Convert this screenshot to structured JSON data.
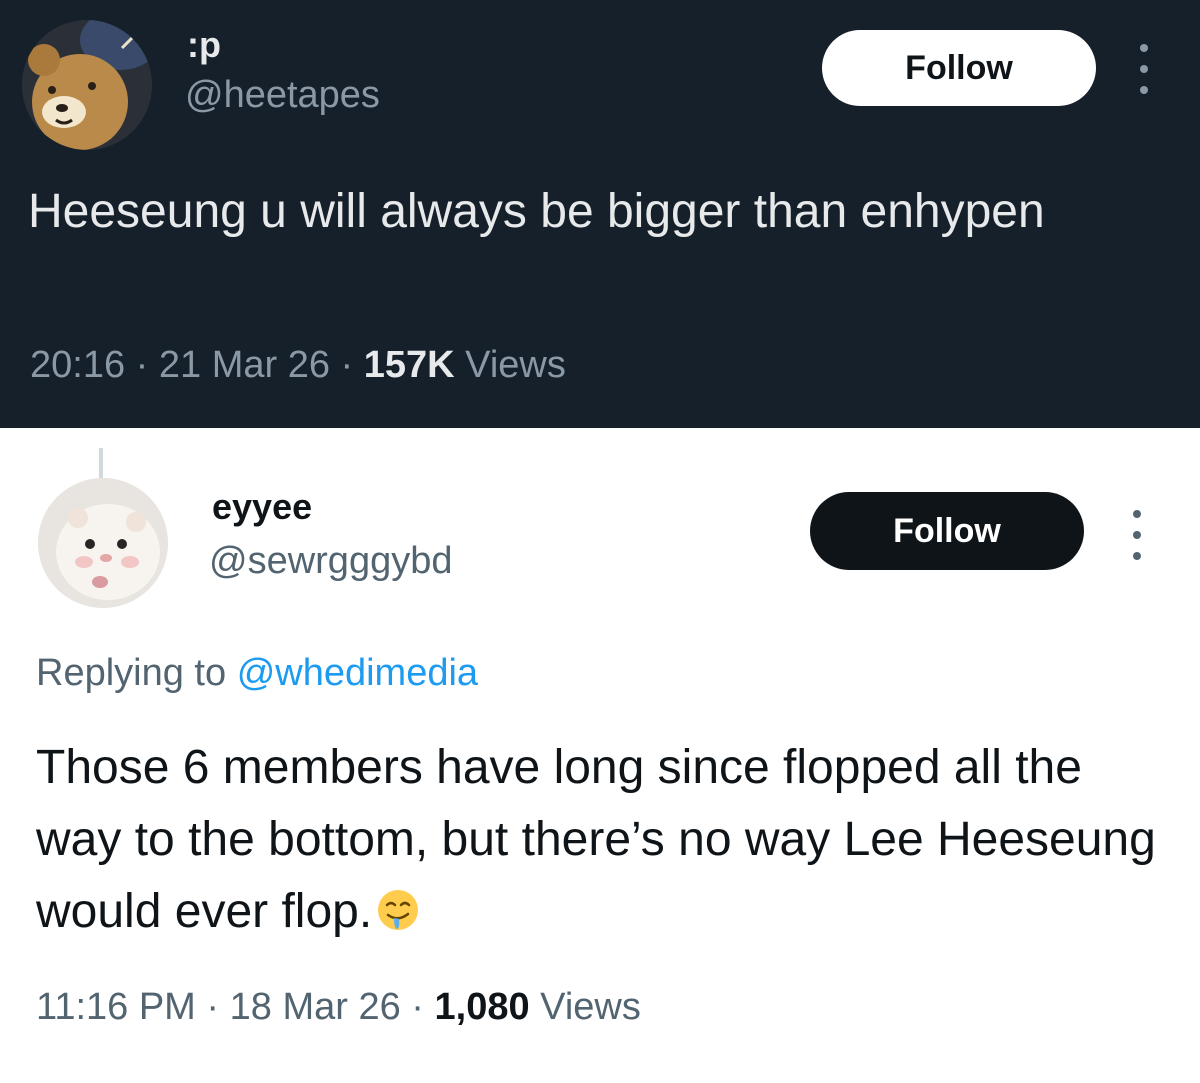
{
  "tweet1": {
    "display_name": ":p",
    "handle": "@heetapes",
    "follow_label": "Follow",
    "text": "Heeseung u will always be bigger than enhypen",
    "time": "20:16",
    "date": "21 Mar 26",
    "views_count": "157K",
    "views_label": "Views",
    "separator": "·",
    "theme": {
      "background": "#15202b",
      "text": "#e7e9ea",
      "muted": "#8b98a5"
    }
  },
  "tweet2": {
    "display_name": "eyyee",
    "handle": "@sewrgggybd",
    "follow_label": "Follow",
    "replying_prefix": "Replying to",
    "replying_to": "@whedimedia",
    "text": "Those 6 members have long since flopped all the way to the bottom, but there’s no way Lee Heeseung would ever flop.",
    "emoji": "drooling-face",
    "time": "11:16 PM",
    "date": "18 Mar 26",
    "views_count": "1,080",
    "views_label": "Views",
    "separator": "·",
    "theme": {
      "background": "#ffffff",
      "text": "#0f1419",
      "muted": "#536471",
      "link": "#1d9bf0"
    }
  }
}
